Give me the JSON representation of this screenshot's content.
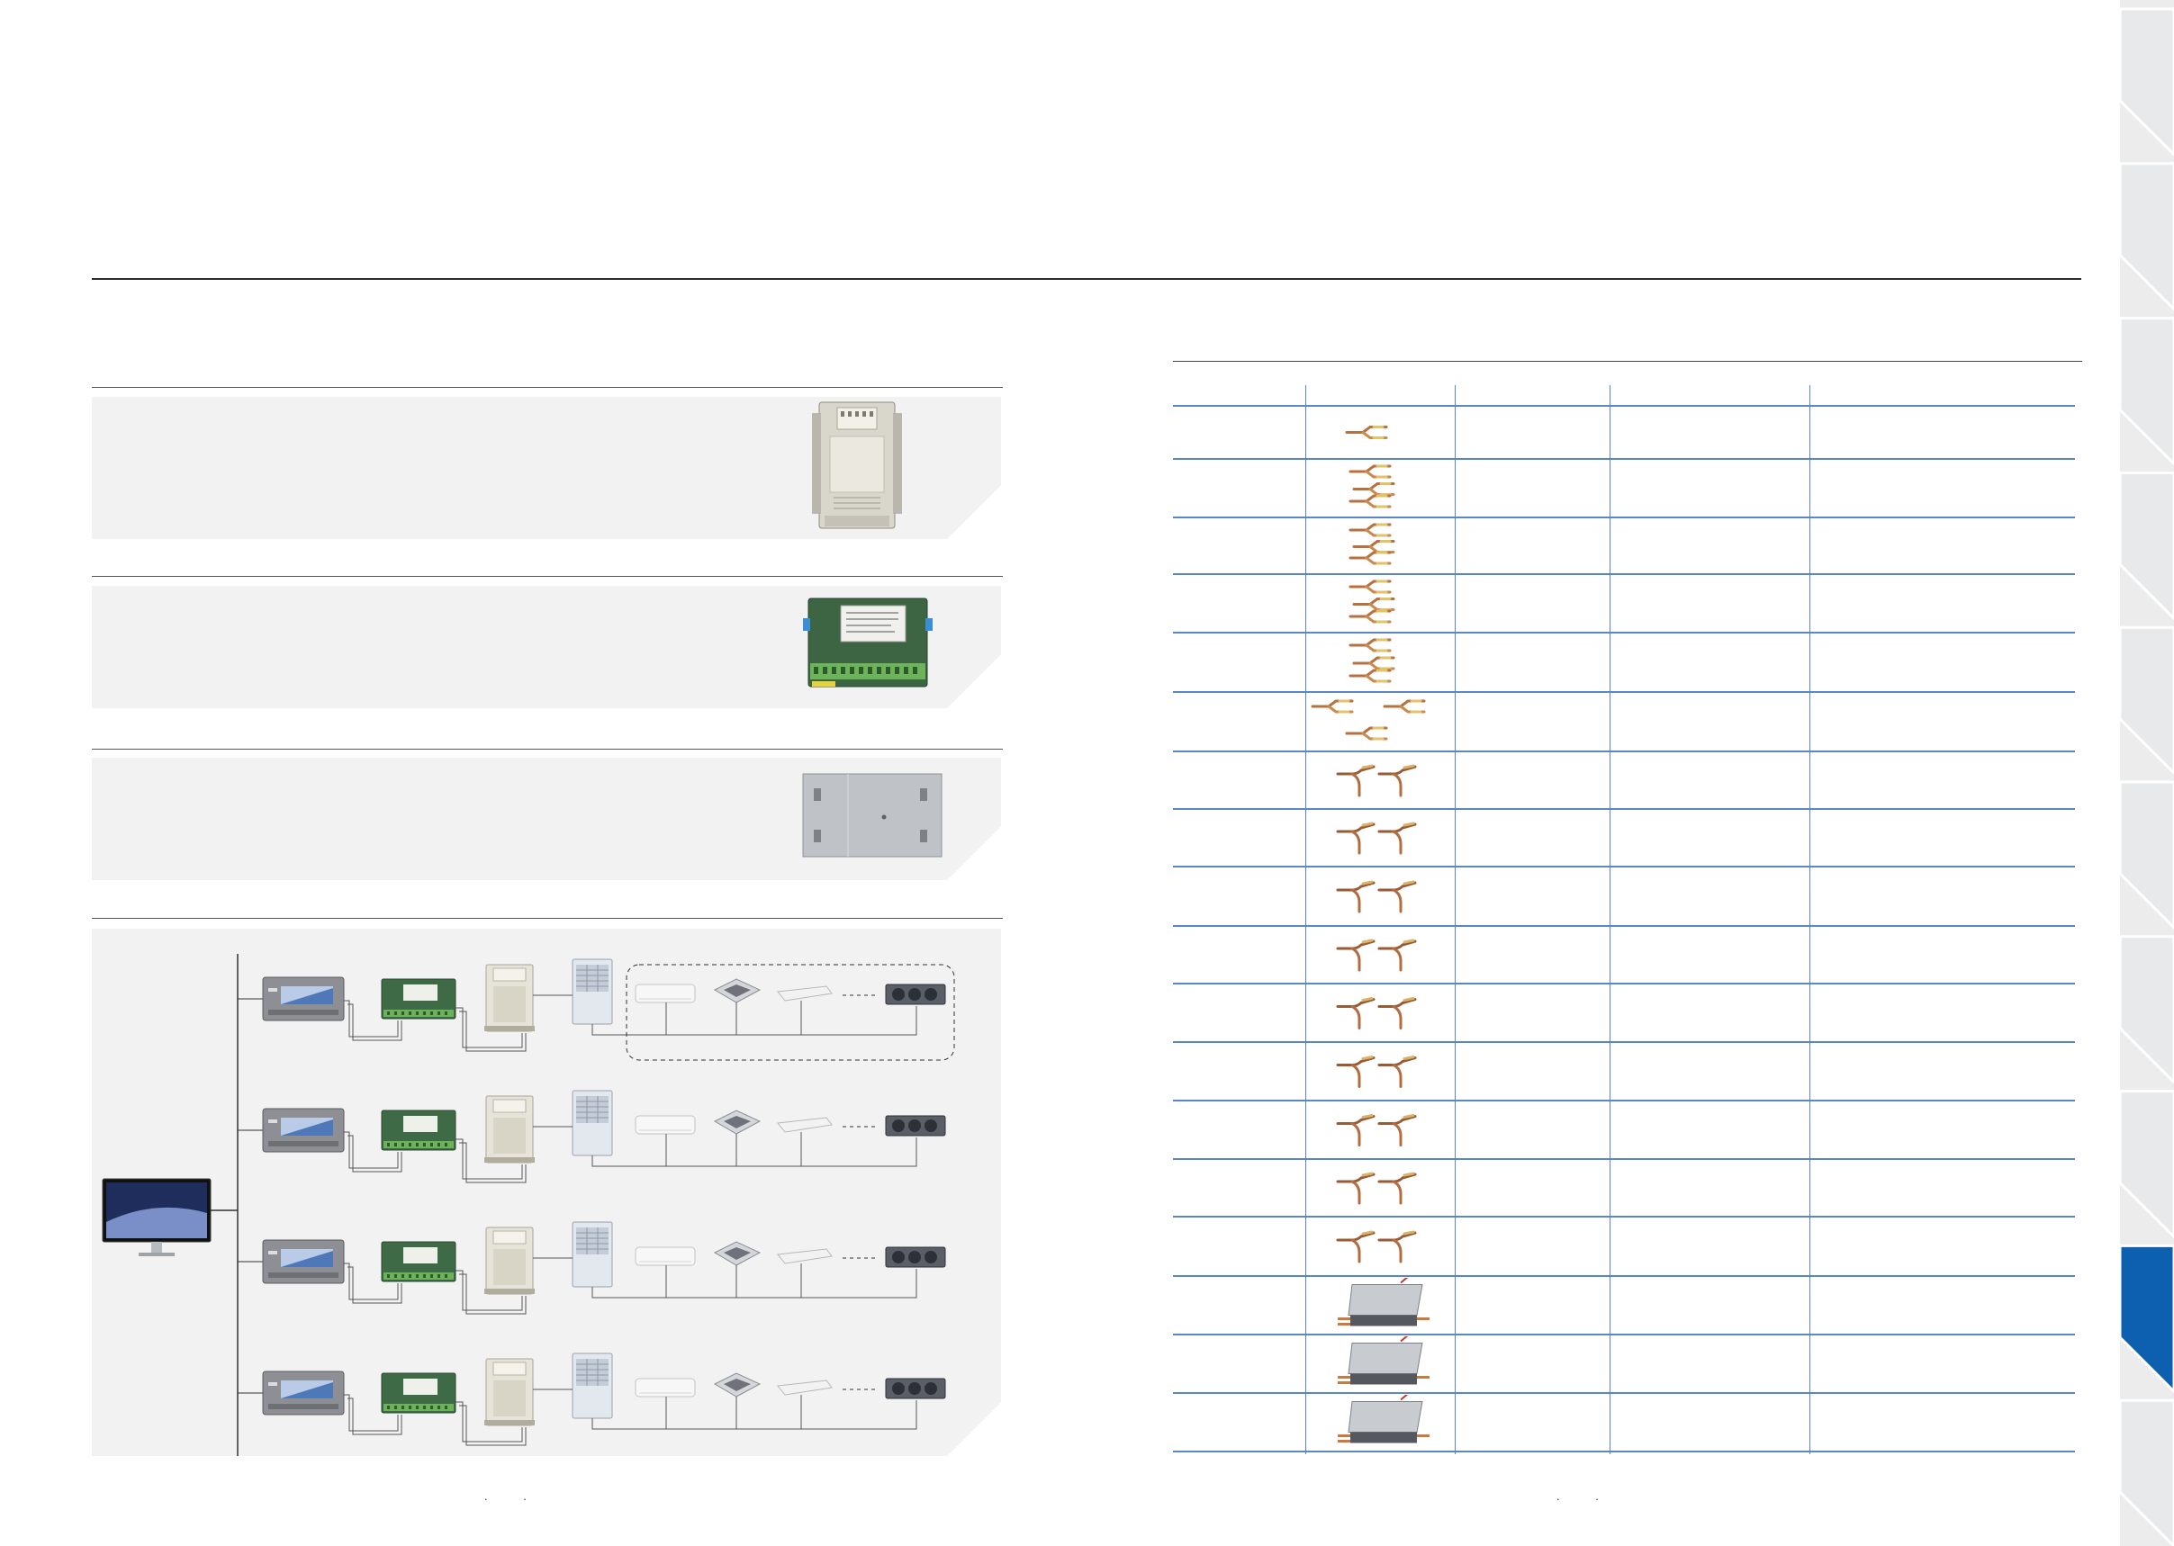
{
  "page": {
    "left_page_number": ". .",
    "right_page_number": ". ."
  },
  "colors": {
    "accent": "#0d5fb0",
    "panel": "#f1f2f1",
    "table_rule": "#5b86c6",
    "tab_gray": "#e8e9ea"
  },
  "side_tabs": {
    "active_index": 8,
    "count": 10
  },
  "branch_table": {
    "rows": [
      {
        "icon": "y-branch-joint-icon"
      },
      {
        "icon": "branch-header-icon"
      },
      {
        "icon": "branch-header-icon"
      },
      {
        "icon": "branch-header-icon"
      },
      {
        "icon": "branch-header-icon"
      },
      {
        "icon": "branch-header-icon"
      },
      {
        "icon": "branch-joint-pair-icon"
      },
      {
        "icon": "branch-joint-pair-icon"
      },
      {
        "icon": "branch-joint-pair-icon"
      },
      {
        "icon": "branch-joint-pair-icon"
      },
      {
        "icon": "branch-joint-pair-icon"
      },
      {
        "icon": "branch-joint-pair-icon"
      },
      {
        "icon": "branch-joint-pair-icon"
      },
      {
        "icon": "branch-joint-pair-icon"
      },
      {
        "icon": "branch-joint-pair-icon"
      },
      {
        "icon": "mode-switch-box-icon"
      },
      {
        "icon": "mode-switch-box-icon"
      },
      {
        "icon": "mode-switch-box-icon"
      }
    ]
  }
}
